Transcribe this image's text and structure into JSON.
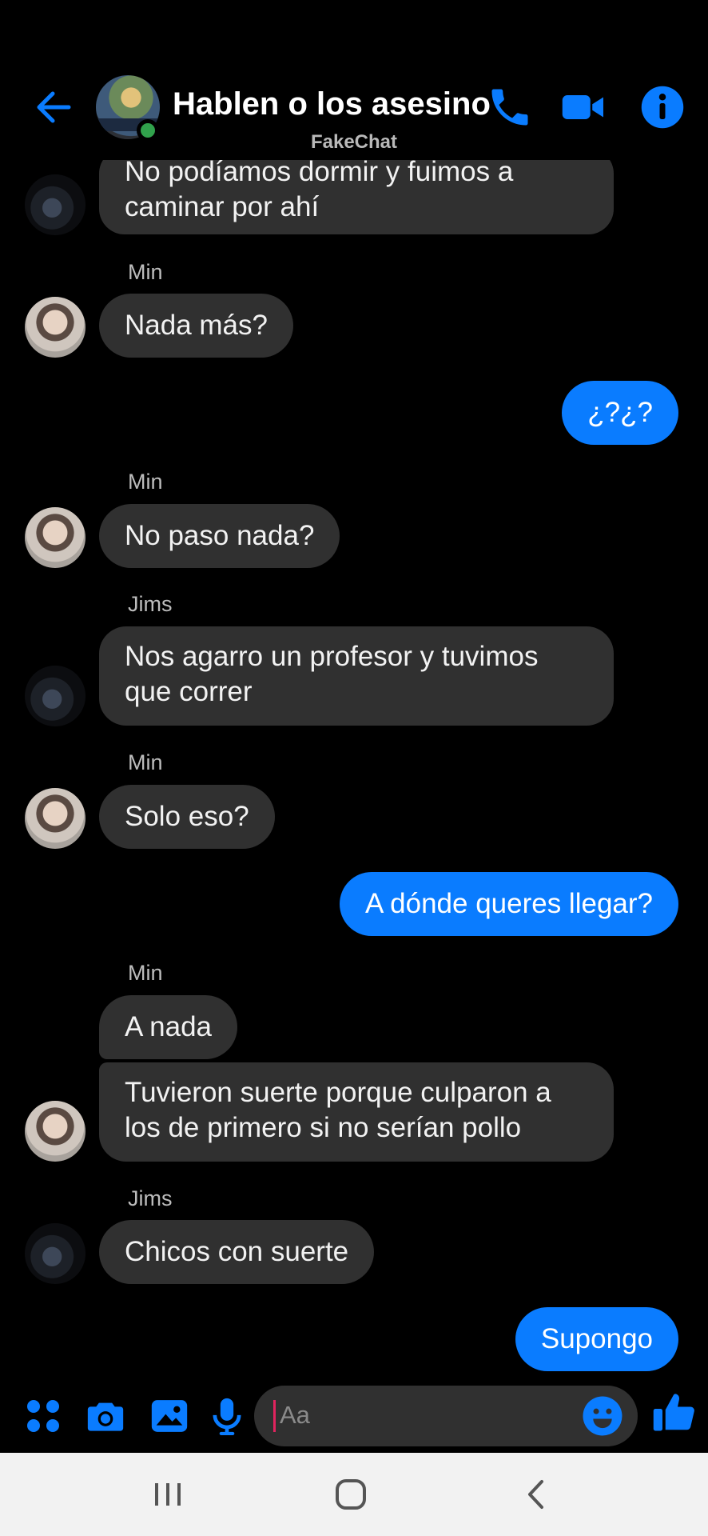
{
  "header": {
    "title": "Hablen o los asesino",
    "watermark": "FakeChat"
  },
  "colors": {
    "accent": "#0a7cff",
    "bubble_in": "#303030",
    "background": "#000000",
    "online": "#31a24c"
  },
  "messages": [
    {
      "sender": "Jims",
      "text_lines": [
        "No podíamos dormir y fuimos a",
        "caminar por ahí"
      ]
    },
    {
      "sender_label": "Min",
      "text": "Nada más?"
    },
    {
      "sender": "me",
      "text": "¿?¿?"
    },
    {
      "sender_label": "Min",
      "text": "No paso nada?"
    },
    {
      "sender_label": "Jims",
      "text_lines": [
        "Nos agarro un profesor y tuvimos",
        "que correr"
      ]
    },
    {
      "sender_label": "Min",
      "text": "Solo eso?"
    },
    {
      "sender": "me",
      "text": "A dónde queres llegar?"
    },
    {
      "sender_label": "Min",
      "text": "A nada"
    },
    {
      "sender": "Min",
      "text_lines": [
        "Tuvieron suerte porque culparon a",
        "los de primero si no serían pollo"
      ]
    },
    {
      "sender_label": "Jims",
      "text": "Chicos con suerte"
    },
    {
      "sender": "me",
      "text": "Supongo"
    }
  ],
  "composer": {
    "placeholder": "Aa",
    "icons": [
      "apps-icon",
      "camera-icon",
      "gallery-icon",
      "microphone-icon",
      "emoji-icon",
      "like-icon"
    ]
  },
  "system_nav": {
    "icons": [
      "recent-apps-icon",
      "home-icon",
      "back-icon"
    ]
  }
}
